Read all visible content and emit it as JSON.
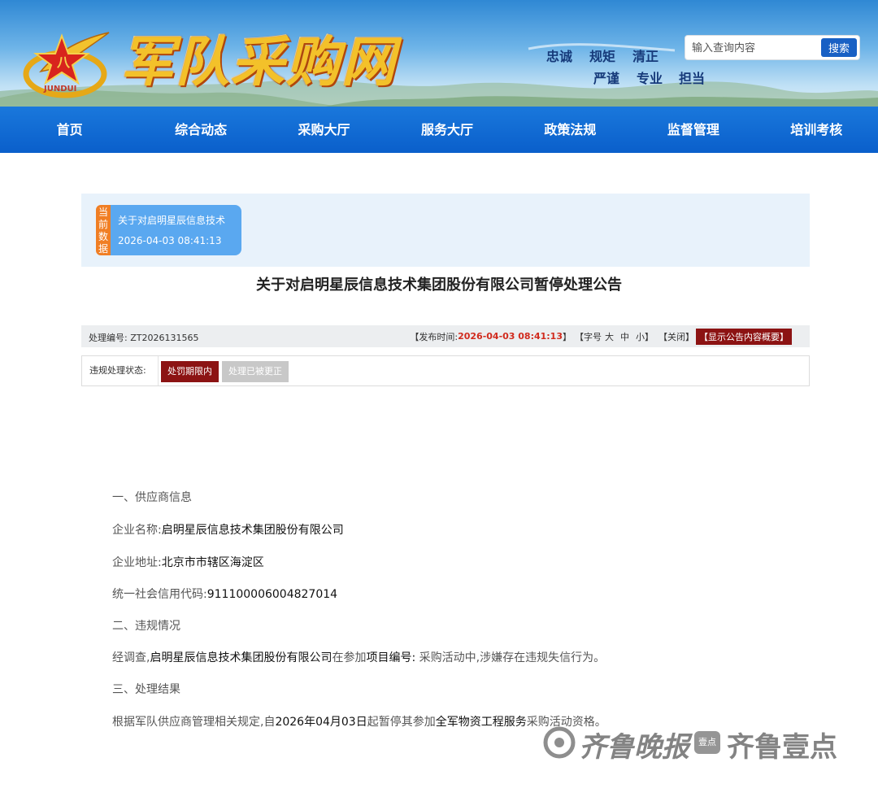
{
  "header": {
    "site_title": "军队采购网",
    "logo_text": "JUNDUI",
    "motto_row1": [
      "忠诚",
      "规矩",
      "清正"
    ],
    "motto_row2": [
      "严谨",
      "专业",
      "担当"
    ],
    "search_placeholder": "输入查询内容",
    "search_button": "搜索"
  },
  "nav": [
    "首页",
    "综合动态",
    "采购大厅",
    "服务大厅",
    "政策法规",
    "监督管理",
    "培训考核"
  ],
  "current_data": {
    "tag": "当前数据",
    "line1": "关于对启明星辰信息技术",
    "line2": "2026-04-03 08:41:13"
  },
  "article": {
    "title": "关于对启明星辰信息技术集团股份有限公司暂停处理公告",
    "number_label": "处理编号:",
    "number_value": "ZT2026131565",
    "publish_label": "【发布时间:",
    "publish_time": "2026-04-03 08:41:13",
    "publish_close": "】",
    "font_label": "【字号",
    "font_sizes": [
      "大",
      "中",
      "小"
    ],
    "font_close": "】",
    "close_link": "【关闭】",
    "summary_button": "【显示公告内容概要】",
    "status_label": "违规处理状态:",
    "status_active": "处罚期限内",
    "status_inactive": "处理已被更正"
  },
  "body": {
    "section1": "一、供应商信息",
    "name_label": "企业名称:",
    "name_value": "启明星辰信息技术集团股份有限公司",
    "address_label": "企业地址:",
    "address_value": "北京市市辖区海淀区",
    "credit_label": "统一社会信用代码:",
    "credit_value": "911100006004827014",
    "section2": "二、违规情况",
    "violation_prefix": "经调查,",
    "violation_company": "启明星辰信息技术集团股份有限公司",
    "violation_mid": "在参加",
    "violation_project": "项目编号:",
    "violation_suffix": " 采购活动中,涉嫌存在违规失信行为。",
    "section3": "三、处理结果",
    "result_prefix": "根据军队供应商管理相关规定,自",
    "result_date": "2026年04月03日",
    "result_mid": "起暂停其参加",
    "result_scope": "全军物资工程服务",
    "result_suffix": "采购活动资格。"
  },
  "watermark": {
    "text1": "齐鲁晚报",
    "badge": "壹点",
    "text2": "齐鲁壹点"
  }
}
